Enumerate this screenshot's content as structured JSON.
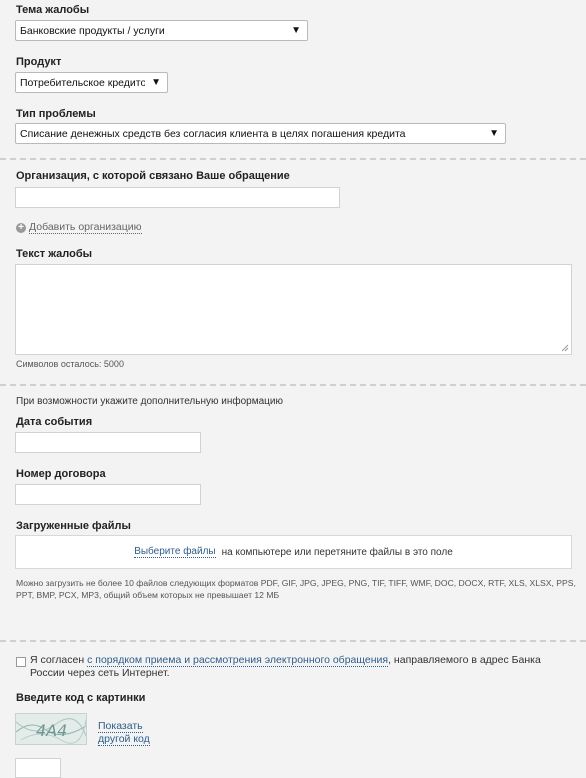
{
  "complaint_topic": {
    "label": "Тема жалобы",
    "value": "Банковские продукты / услуги"
  },
  "product": {
    "label": "Продукт",
    "value": "Потребительское кредитование"
  },
  "problem_type": {
    "label": "Тип проблемы",
    "value": "Списание денежных средств без согласия клиента в целях погашения кредита"
  },
  "organization": {
    "label": "Организация, с которой связано Ваше обращение",
    "value": ""
  },
  "add_organization": "Добавить организацию",
  "complaint_text": {
    "label": "Текст жалобы",
    "value": "",
    "chars_left": "Символов осталось: 5000"
  },
  "additional_info": "При возможности укажите дополнительную информацию",
  "event_date": {
    "label": "Дата события",
    "value": ""
  },
  "contract_number": {
    "label": "Номер договора",
    "value": ""
  },
  "uploaded_files": {
    "label": "Загруженные файлы",
    "choose_link": "Выберите файлы",
    "drop_text": "на компьютере или перетяните файлы в это поле",
    "note": "Можно загрузить не более 10 файлов следующих форматов PDF, GIF, JPG, JPEG, PNG, TIF, TIFF, WMF, DOC, DOCX, RTF, XLS, XLSX, PPS, PPT, BMP, PCX, MP3, общий объем которых не превышает 12 МБ"
  },
  "agreement": {
    "prefix": "Я согласен",
    "link": "с порядком приема и рассмотрения электронного обращения",
    "suffix": ", направляемого в адрес Банка России через сеть Интернет.",
    "checked": false
  },
  "captcha": {
    "label": "Введите код с картинки",
    "image_text": "4A4",
    "refresh_line1": "Показать",
    "refresh_line2": "другой код"
  },
  "colors": {
    "link": "#2e5d8a",
    "background": "#f3f3f3"
  }
}
